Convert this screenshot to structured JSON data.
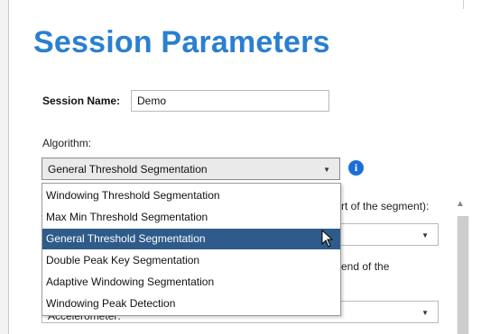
{
  "title": "Session Parameters",
  "session": {
    "label": "Session Name:",
    "value": "Demo"
  },
  "algorithm": {
    "label": "Algorithm:",
    "selected": "General Threshold Segmentation",
    "options": [
      "Windowing Threshold Segmentation",
      "Max Min Threshold Segmentation",
      "General Threshold Segmentation",
      "Double Peak Key Segmentation",
      "Adaptive Windowing Segmentation",
      "Windowing Peak Detection"
    ],
    "highlighted": "General Threshold Segmentation",
    "info_icon": "info-icon"
  },
  "background": {
    "partial_label_1": "rt of the segment):",
    "partial_label_2": "end of the",
    "partial_combo_value": "Accelerometer:"
  },
  "colors": {
    "title": "#2a7fd0",
    "highlight": "#2f5b8a",
    "info": "#1a6fd6"
  }
}
